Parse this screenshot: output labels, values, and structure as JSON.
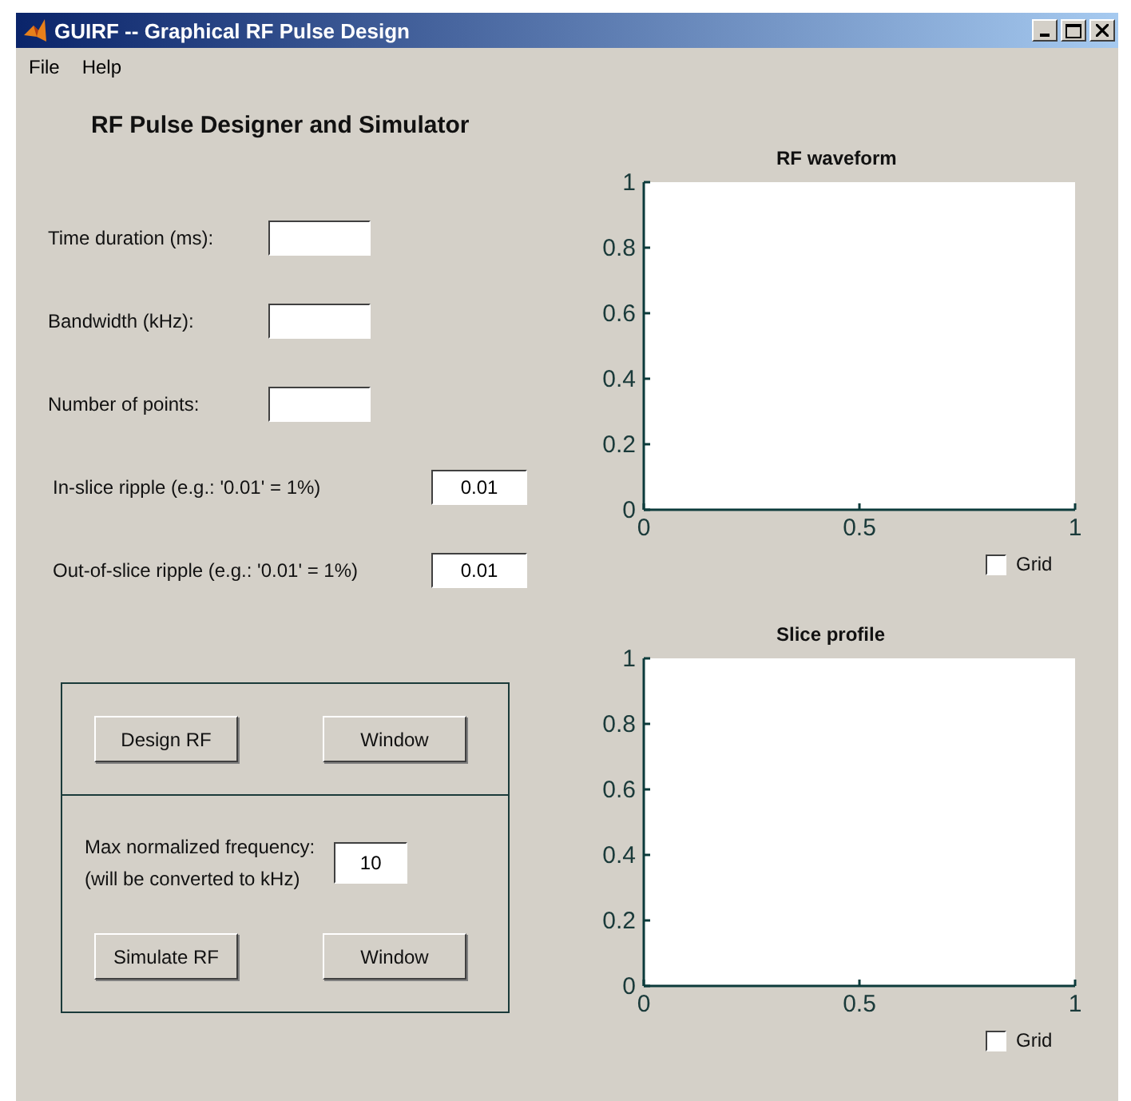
{
  "window": {
    "title": "GUIRF -- Graphical RF Pulse Design"
  },
  "menu": [
    "File",
    "Help"
  ],
  "heading": "RF Pulse Designer and Simulator",
  "fields": [
    {
      "label": "Time duration (ms):",
      "kind": "short"
    },
    {
      "label": "Bandwidth (kHz):",
      "kind": "short"
    },
    {
      "label": "Number of points:",
      "kind": "short"
    },
    {
      "label": "In-slice ripple (e.g.: '0.01' = 1%)",
      "value": "0.01",
      "kind": "long"
    },
    {
      "label": "Out-of-slice ripple (e.g.: '0.01' = 1%)",
      "value": "0.01",
      "kind": "long"
    }
  ],
  "design_panel": {
    "buttons": [
      "Design RF",
      "Window"
    ]
  },
  "simulate_panel": {
    "label_lines": [
      "Max normalized frequency:",
      "(will be converted to kHz)"
    ],
    "value": "10",
    "buttons": [
      "Simulate RF",
      "Window"
    ]
  },
  "plots": [
    {
      "chart_data": {
        "type": "line",
        "title": "RF waveform",
        "xlim": [
          0,
          1
        ],
        "ylim": [
          0,
          1
        ],
        "xticks": [
          0,
          0.5,
          1
        ],
        "yticks": [
          0,
          0.2,
          0.4,
          0.6,
          0.8,
          1
        ]
      },
      "grid": {
        "label": "Grid",
        "checked": false
      }
    },
    {
      "chart_data": {
        "type": "line",
        "title": "Slice profile",
        "xlim": [
          0,
          1
        ],
        "ylim": [
          0,
          1
        ],
        "xticks": [
          0,
          0.5,
          1
        ],
        "yticks": [
          0,
          0.2,
          0.4,
          0.6,
          0.8,
          1
        ]
      },
      "grid": {
        "label": "Grid",
        "checked": false
      }
    }
  ]
}
